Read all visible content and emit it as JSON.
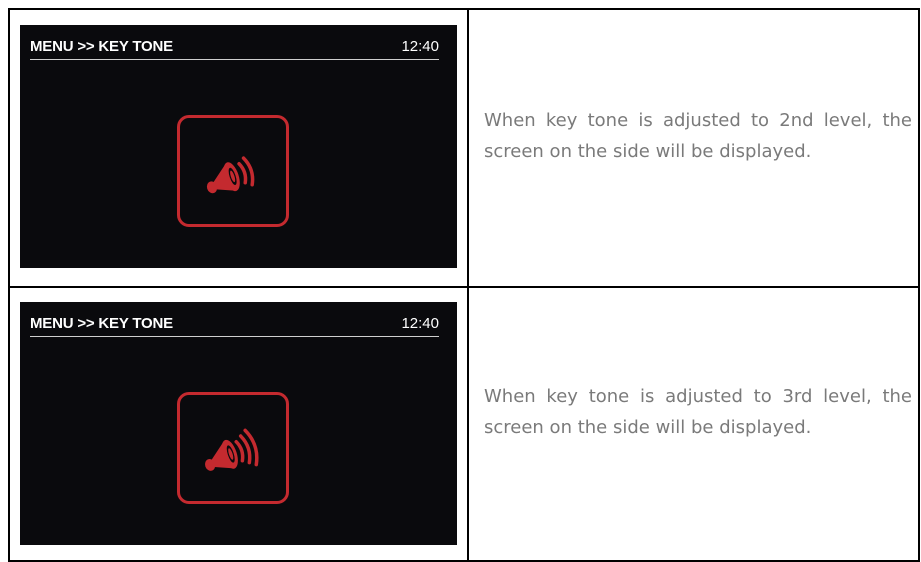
{
  "rows": [
    {
      "screen": {
        "title": "MENU >> KEY TONE",
        "time": "12:40",
        "icon": "speaker-level-2-icon"
      },
      "description": "When key tone is adjusted to 2nd level, the screen on the side will be displayed."
    },
    {
      "screen": {
        "title": "MENU >> KEY TONE",
        "time": "12:40",
        "icon": "speaker-level-3-icon"
      },
      "description": "When key tone is adjusted to 3rd level, the screen on the side will be displayed."
    }
  ],
  "colors": {
    "screen_background": "#0a0a0d",
    "icon_accent": "#c42a2f",
    "description_text": "#7a7a7a"
  }
}
